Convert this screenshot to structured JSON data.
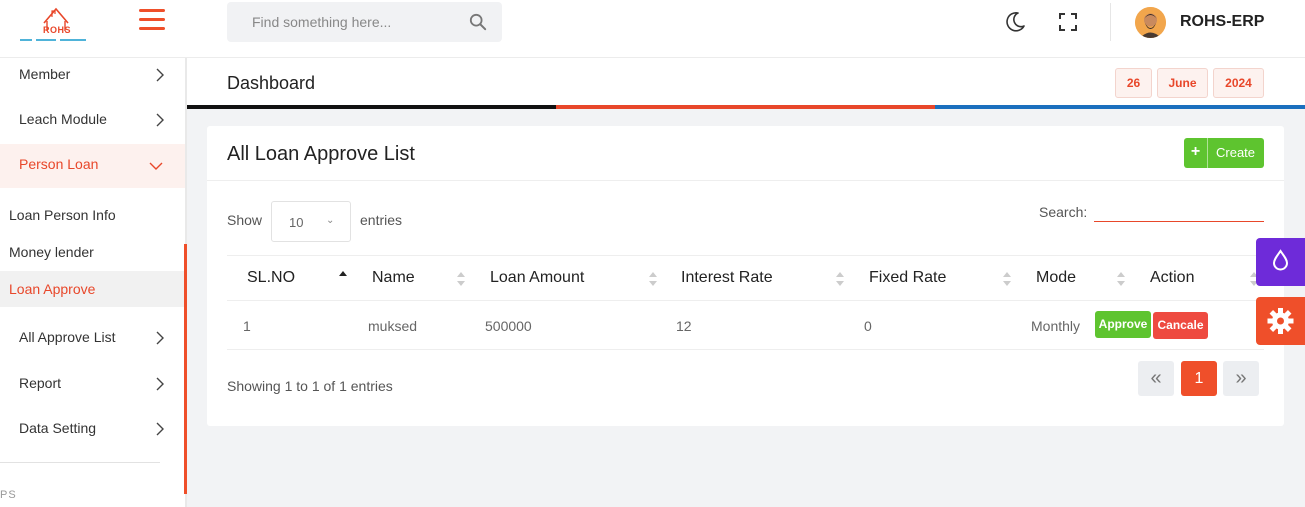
{
  "header": {
    "logo_text": "ROHS",
    "search_placeholder": "Find something here...",
    "brand": "ROHS-ERP"
  },
  "sidebar": {
    "items": [
      {
        "label": "Member"
      },
      {
        "label": "Leach Module"
      },
      {
        "label": "Person Loan"
      },
      {
        "label": "All Approve List"
      },
      {
        "label": "Report"
      },
      {
        "label": "Data Setting"
      }
    ],
    "sub_items": [
      {
        "label": "Loan Person Info"
      },
      {
        "label": "Money lender"
      },
      {
        "label": "Loan Approve"
      }
    ],
    "section_label": "PS"
  },
  "page": {
    "title": "Dashboard",
    "date": {
      "day": "26",
      "month": "June",
      "year": "2024"
    }
  },
  "card": {
    "title": "All Loan Approve List",
    "create_label": "Create",
    "show_label": "Show",
    "entries_label": "entries",
    "page_length": "10",
    "search_label": "Search:",
    "columns": [
      "SL.NO",
      "Name",
      "Loan Amount",
      "Interest Rate",
      "Fixed Rate",
      "Mode",
      "Action"
    ],
    "rows": [
      {
        "sl": "1",
        "name": "muksed",
        "amount": "500000",
        "interest": "12",
        "fixed": "0",
        "mode": "Monthly",
        "approve": "Approve",
        "cancel": "Cancale"
      }
    ],
    "info": "Showing 1 to 1 of 1 entries",
    "pagination": {
      "prev": "«",
      "current": "1",
      "next": "»"
    }
  },
  "colors": {
    "accent": "#ef4f2a",
    "success": "#5ec42f",
    "danger": "#ee4a40",
    "purple": "#6e2bd9",
    "blue": "#1a6fbe"
  },
  "icons": [
    "logo-icon",
    "menu-icon",
    "search-icon",
    "moon-icon",
    "fullscreen-icon",
    "avatar",
    "chevron-right-icon",
    "chevron-down-icon",
    "plus-icon",
    "sort-icon",
    "drop-icon",
    "gear-icon"
  ]
}
